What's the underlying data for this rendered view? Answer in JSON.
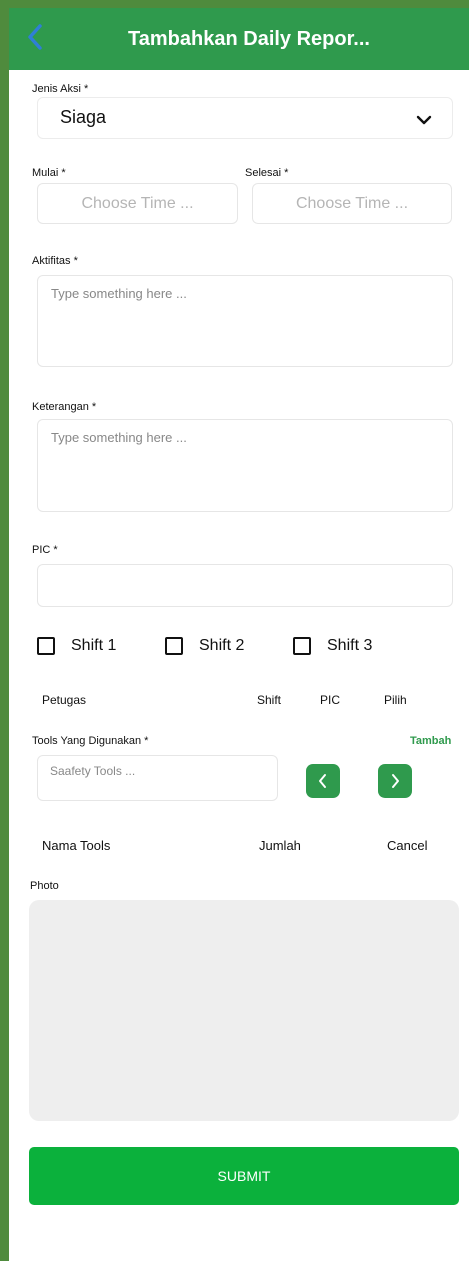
{
  "header": {
    "title": "Tambahkan Daily Repor..."
  },
  "form": {
    "jenis_aksi": {
      "label": "Jenis Aksi *",
      "value": "Siaga"
    },
    "mulai": {
      "label": "Mulai *",
      "placeholder": "Choose Time ..."
    },
    "selesai": {
      "label": "Selesai *",
      "placeholder": "Choose Time ..."
    },
    "aktifitas": {
      "label": "Aktifitas *",
      "placeholder": "Type something here ..."
    },
    "keterangan": {
      "label": "Keterangan *",
      "placeholder": "Type something here ..."
    },
    "pic": {
      "label": "PIC *",
      "value": ""
    },
    "shifts": [
      "Shift 1",
      "Shift 2",
      "Shift 3"
    ],
    "petugas_table": {
      "columns": [
        "Petugas",
        "Shift",
        "PIC",
        "Pilih"
      ]
    },
    "tools": {
      "label": "Tools Yang Digunakan *",
      "add_label": "Tambah",
      "placeholder": "Saafety Tools ..."
    },
    "tools_table": {
      "columns": [
        "Nama Tools",
        "Jumlah",
        "Cancel"
      ]
    },
    "photo": {
      "label": "Photo"
    },
    "submit_label": "SUBMIT"
  },
  "colors": {
    "primary": "#2f9a4d",
    "submit": "#0bb13c",
    "frame": "#4f8b3d"
  },
  "icons": {
    "back": "back-arrow-icon",
    "dropdown": "chevron-down-icon",
    "prev": "chevron-left-icon",
    "next": "chevron-right-icon"
  }
}
